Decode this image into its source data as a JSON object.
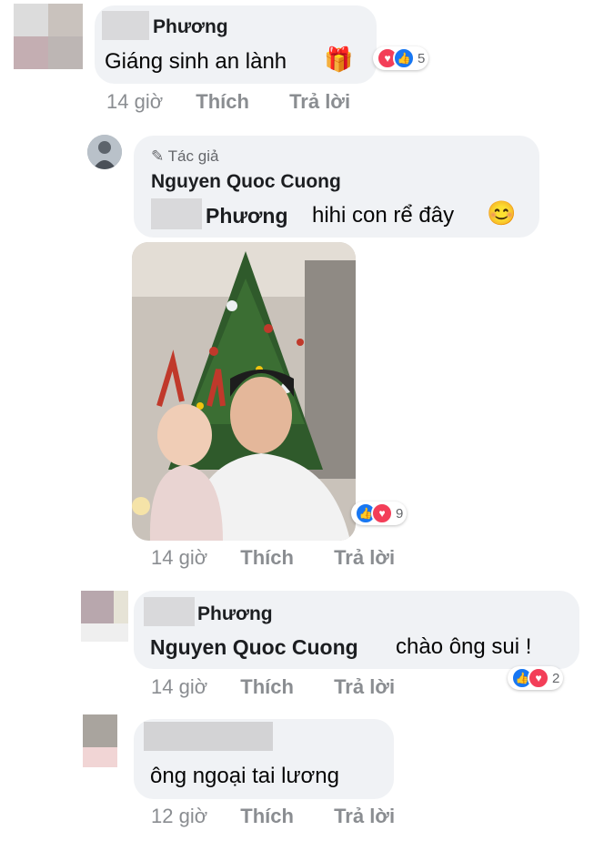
{
  "comments": [
    {
      "author": "Phương",
      "text": "Giáng sinh an lành",
      "emoji": "🎁",
      "time": "14 giờ",
      "like_label": "Thích",
      "reply_label": "Trả lời",
      "reaction_count": "5"
    },
    {
      "badge": "Tác giả",
      "author": "Nguyen Quoc Cuong",
      "mention": "Phương",
      "text": "hihi con rể đây",
      "emoji": "😊",
      "time": "14 giờ",
      "like_label": "Thích",
      "reply_label": "Trả lời",
      "reaction_count": "9"
    },
    {
      "author": "Phương",
      "mention": "Nguyen Quoc Cuong",
      "text": "chào ông sui !",
      "time": "14 giờ",
      "like_label": "Thích",
      "reply_label": "Trả lời",
      "reaction_count": "2"
    },
    {
      "author": "",
      "text": "ông ngoại tai lương",
      "time": "12 giờ",
      "like_label": "Thích",
      "reply_label": "Trả lời"
    }
  ],
  "colors": {
    "bubble": "#f0f2f5",
    "meta": "#8a8d91",
    "like": "#1877f2",
    "love": "#f33e58"
  },
  "icons": [
    "like-reaction-icon",
    "love-reaction-icon",
    "gift-emoji",
    "smile-emoji",
    "pencil-icon"
  ]
}
